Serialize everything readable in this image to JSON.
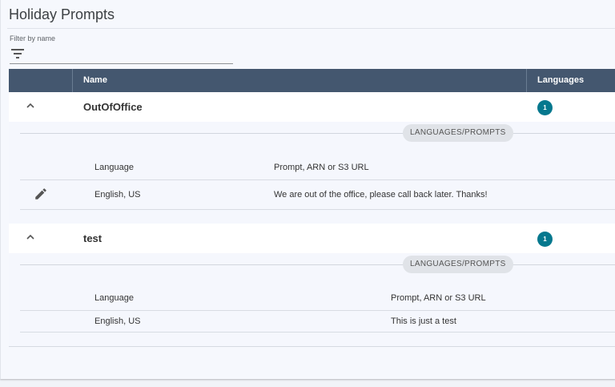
{
  "page": {
    "title": "Holiday Prompts"
  },
  "filter": {
    "label": "Filter by name",
    "value": ""
  },
  "table": {
    "columns": [
      "",
      "Name",
      "Languages"
    ],
    "groups": [
      {
        "name": "OutOfOffice",
        "language_count": "1",
        "expanded": true,
        "section_label": "LANGUAGES/PROMPTS",
        "sub_headers": [
          "Language",
          "Prompt, ARN or S3 URL"
        ],
        "rows": [
          {
            "language": "English, US",
            "prompt": "We are out of the office, please call back later. Thanks!",
            "editable": true
          }
        ]
      },
      {
        "name": "test",
        "language_count": "1",
        "expanded": true,
        "section_label": "LANGUAGES/PROMPTS",
        "sub_headers": [
          "Language",
          "Prompt, ARN or S3 URL"
        ],
        "rows": [
          {
            "language": "English, US",
            "prompt": "This is just a test",
            "editable": false
          }
        ]
      }
    ]
  },
  "icons": {
    "filter": "filter-icon",
    "expand": "chevron-up-icon",
    "edit": "pencil-icon"
  },
  "colors": {
    "header_bg": "#44576f",
    "badge": "#05788e",
    "row_bg": "#ffffff",
    "detail_bg": "#f5f7fd"
  }
}
